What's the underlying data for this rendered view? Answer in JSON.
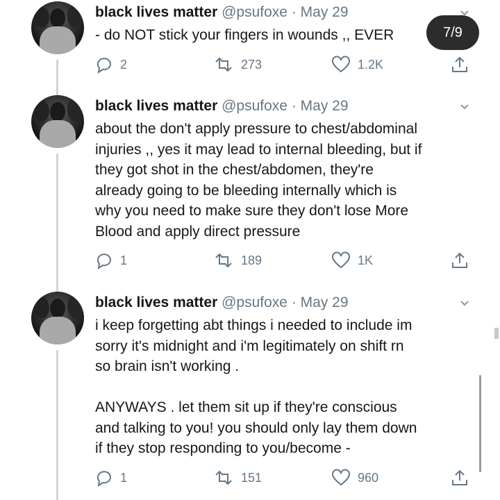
{
  "colors": {
    "text": "#14171a",
    "secondary": "#657786",
    "thread": "#ccd6dd",
    "badge_bg": "#2c2c2c"
  },
  "badge": {
    "label": "7/9"
  },
  "tweets": [
    {
      "name": "black lives matter",
      "handle": "@psufoxe",
      "separator": "·",
      "date": "May 29",
      "text": "- do NOT stick your fingers in wounds ,, EVER",
      "replies": "2",
      "retweets": "273",
      "likes": "1.2K"
    },
    {
      "name": "black lives matter",
      "handle": "@psufoxe",
      "separator": "·",
      "date": "May 29",
      "text": "about the don't apply pressure to chest/abdominal\ninjuries ,, yes it may lead to internal bleeding, but if\nthey got shot in the chest/abdomen, they're\nalready going to be bleeding internally which is\nwhy you need to make sure they don't lose More\nBlood and apply direct pressure",
      "replies": "1",
      "retweets": "189",
      "likes": "1K"
    },
    {
      "name": "black lives matter",
      "handle": "@psufoxe",
      "separator": "·",
      "date": "May 29",
      "text": "i keep forgetting abt things i needed to include im\nsorry it's midnight and i'm legitimately on shift rn\nso brain isn't working .\n\nANYWAYS . let them sit up if they're conscious\nand talking to you! you should only lay them down\nif they stop responding to you/become -",
      "replies": "1",
      "retweets": "151",
      "likes": "960"
    }
  ]
}
